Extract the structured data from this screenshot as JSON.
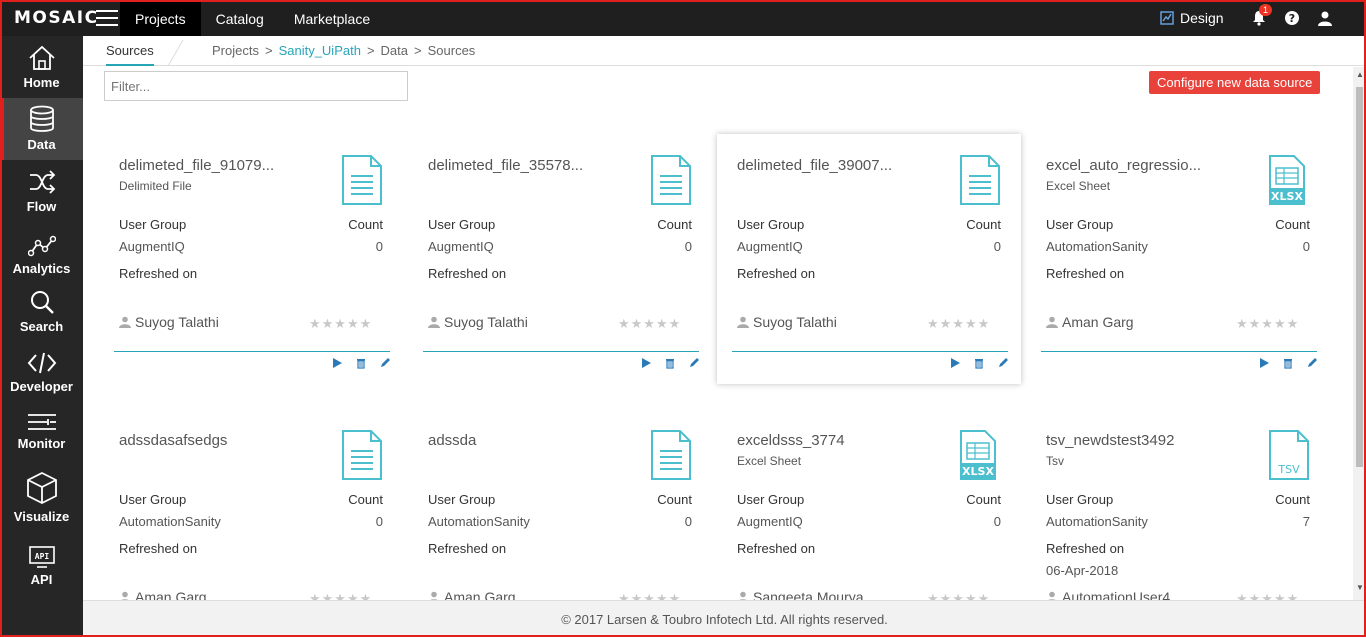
{
  "app": {
    "logo": "MOSAIC"
  },
  "topnav": {
    "items": [
      "Projects",
      "Catalog",
      "Marketplace"
    ],
    "active": "Projects",
    "design_label": "Design",
    "notification_count": "1"
  },
  "sidebar": {
    "items": [
      {
        "label": "Home",
        "icon": "home-icon"
      },
      {
        "label": "Data",
        "icon": "database-icon",
        "active": true
      },
      {
        "label": "Flow",
        "icon": "shuffle-icon"
      },
      {
        "label": "Analytics",
        "icon": "analytics-icon"
      },
      {
        "label": "Search",
        "icon": "search-icon"
      },
      {
        "label": "Developer",
        "icon": "code-icon"
      },
      {
        "label": "Monitor",
        "icon": "monitor-icon"
      },
      {
        "label": "Visualize",
        "icon": "cube-icon"
      },
      {
        "label": "API",
        "icon": "api-icon"
      }
    ]
  },
  "subheader": {
    "tab": "Sources",
    "breadcrumb": [
      "Projects",
      ">",
      "Sanity_UiPath",
      ">",
      "Data",
      ">",
      "Sources"
    ]
  },
  "filter": {
    "placeholder": "Filter..."
  },
  "config_button": "Configure new data source",
  "labels": {
    "user_group": "User Group",
    "count": "Count",
    "refreshed_on": "Refreshed on"
  },
  "cards": [
    {
      "title": "delimeted_file_91079...",
      "type": "Delimited File",
      "group": "AugmentIQ",
      "count": "0",
      "refreshed": "",
      "owner": "Suyog Talathi",
      "icon": "file-icon"
    },
    {
      "title": "delimeted_file_35578...",
      "type": "",
      "group": "AugmentIQ",
      "count": "0",
      "refreshed": "",
      "owner": "Suyog Talathi",
      "icon": "file-icon"
    },
    {
      "title": "delimeted_file_39007...",
      "type": "",
      "group": "AugmentIQ",
      "count": "0",
      "refreshed": "",
      "owner": "Suyog Talathi",
      "icon": "file-icon"
    },
    {
      "title": "excel_auto_regressio...",
      "type": "Excel Sheet",
      "group": "AutomationSanity",
      "count": "0",
      "refreshed": "",
      "owner": "Aman Garg",
      "icon": "xlsx-icon"
    },
    {
      "title": "adssdasafsedgs",
      "type": "",
      "group": "AutomationSanity",
      "count": "0",
      "refreshed": "",
      "owner": "Aman Garg",
      "icon": "file-icon"
    },
    {
      "title": "adssda",
      "type": "",
      "group": "AutomationSanity",
      "count": "0",
      "refreshed": "",
      "owner": "Aman Garg",
      "icon": "file-icon"
    },
    {
      "title": "exceldsss_3774",
      "type": "Excel Sheet",
      "group": "AugmentIQ",
      "count": "0",
      "refreshed": "",
      "owner": "Sangeeta Mourya",
      "icon": "xlsx-icon"
    },
    {
      "title": "tsv_newdstest3492",
      "type": "Tsv",
      "group": "AutomationSanity",
      "count": "7",
      "refreshed": "06-Apr-2018",
      "owner": "AutomationUser4",
      "icon": "tsv-icon"
    }
  ],
  "footer": "© 2017 Larsen & Toubro Infotech Ltd. All rights reserved.",
  "colors": {
    "accent": "#27a5b8",
    "danger": "#e8423b",
    "topbar": "#1f1f1f",
    "sidebar": "#262626"
  }
}
